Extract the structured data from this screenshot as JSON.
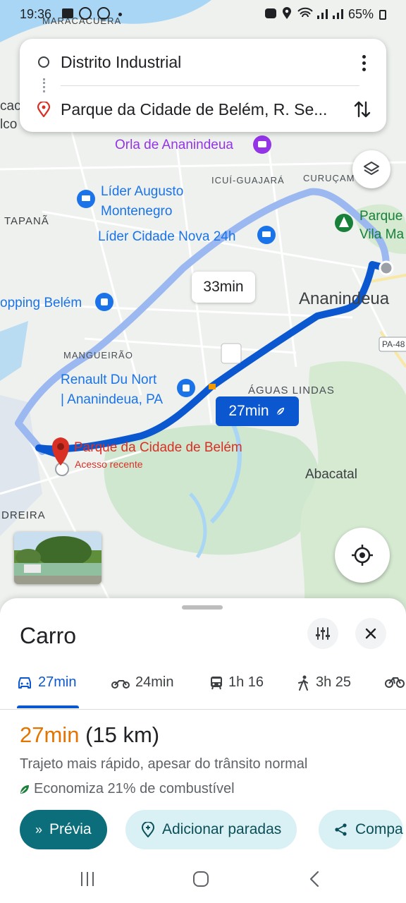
{
  "status_bar": {
    "time": "19:36",
    "battery": "65%"
  },
  "search": {
    "origin": "Distrito Industrial",
    "destination": "Parque da Cidade de Belém, R. Se..."
  },
  "map": {
    "labels": {
      "maracacuera": "MARACACUERA",
      "orla": "Orla de Ananindeua",
      "icui": "ICUÍ-GUAJARÁ",
      "curucam": "CURUÇAM",
      "parque_vila_1": "Parque",
      "parque_vila_2": "Vila Ma",
      "lider_augusto_1": "Líder Augusto",
      "lider_augusto_2": "Montenegro",
      "tapana": "TAPANÃ",
      "lider_cidade_nova": "Líder Cidade Nova 24h",
      "shopping": "opping Belém",
      "ananindeua": "Ananindeua",
      "pa_road": "PA-48",
      "mangueirao": "MANGUEIRÃO",
      "renault_1": "Renault Du Nort",
      "renault_2": "| Ananindeua, PA",
      "aguas_lindas": "ÁGUAS LINDAS",
      "dest_name": "Parque da Cidade de Belém",
      "dest_sub": "Acesso recente",
      "abacatal": "Abacatal",
      "dreira": "DREIRA",
      "edge_1": "cac",
      "edge_2": "lco"
    },
    "route_alt_time": "33min",
    "route_main_time": "27min"
  },
  "sheet": {
    "title": "Carro",
    "tabs": [
      {
        "label": "27min",
        "icon": "car-icon"
      },
      {
        "label": "24min",
        "icon": "motorcycle-icon"
      },
      {
        "label": "1h 16",
        "icon": "transit-icon"
      },
      {
        "label": "3h 25",
        "icon": "walk-icon"
      }
    ],
    "eta_time": "27min",
    "eta_distance": "(15 km)",
    "description": "Trajeto mais rápido, apesar do trânsito normal",
    "fuel": "Economiza 21% de combustível",
    "buttons": {
      "preview": "Prévia",
      "add_stops": "Adicionar paradas",
      "share": "Compa"
    }
  },
  "colors": {
    "route_main": "#0b57d0",
    "route_alt": "#9cb8f0",
    "destination": "#d93025",
    "eta": "#e37400",
    "primary_button": "#0b6e7a"
  }
}
